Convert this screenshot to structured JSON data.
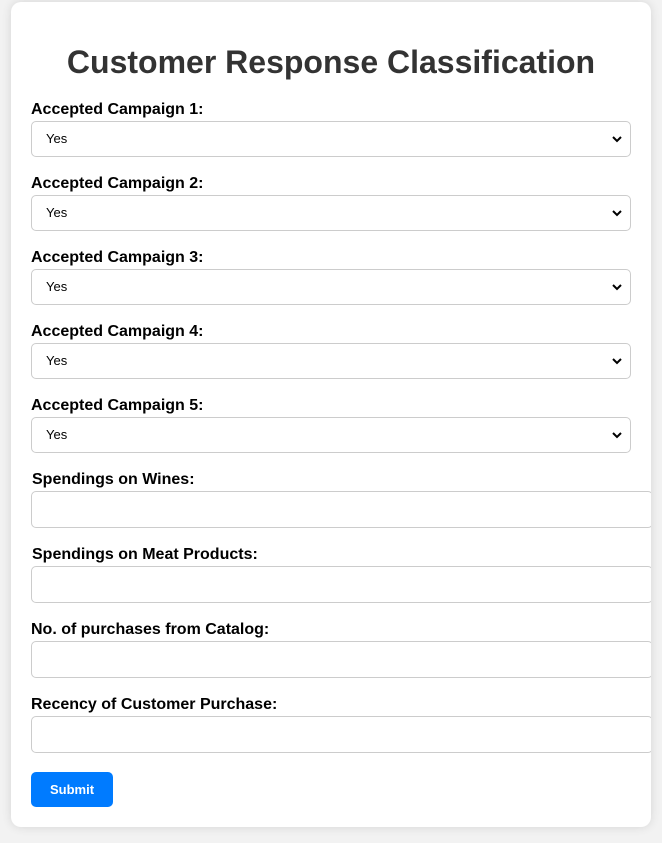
{
  "form": {
    "title": "Customer Response Classification",
    "selects": [
      {
        "label": "Accepted Campaign 1:",
        "value": "Yes"
      },
      {
        "label": "Accepted Campaign 2:",
        "value": "Yes"
      },
      {
        "label": "Accepted Campaign 3:",
        "value": "Yes"
      },
      {
        "label": "Accepted Campaign 4:",
        "value": "Yes"
      },
      {
        "label": "Accepted Campaign 5:",
        "value": "Yes"
      }
    ],
    "inputs": [
      {
        "label": "Spendings on Wines:",
        "value": ""
      },
      {
        "label": "Spendings on Meat Products:",
        "value": ""
      },
      {
        "label": "No. of purchases from Catalog:",
        "value": ""
      },
      {
        "label": "Recency of Customer Purchase:",
        "value": ""
      }
    ],
    "submit_label": "Submit"
  },
  "colors": {
    "accent": "#007bff",
    "title_text": "#333333",
    "border": "#cccccc",
    "page_background": "#f2f2f2"
  },
  "icons": {
    "select_arrow": "chevron-down-icon"
  }
}
